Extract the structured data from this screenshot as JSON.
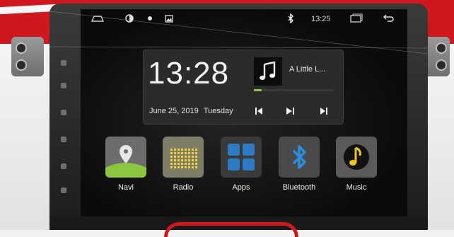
{
  "status_bar": {
    "bluetooth_icon": "bluetooth-icon",
    "time": "13:25"
  },
  "clock_widget": {
    "time": "13:28",
    "date": "June 25, 2019",
    "weekday": "Tuesday"
  },
  "now_playing": {
    "track": "A Little L...",
    "progress": 0.1
  },
  "apps": [
    {
      "label": "Navi",
      "icon": "map-pin-icon",
      "color": "#7a7a7a"
    },
    {
      "label": "Radio",
      "icon": "radio-grid-icon",
      "color": "#8a8a6a"
    },
    {
      "label": "Apps",
      "icon": "apps-grid-icon",
      "color": "#2c7bc4"
    },
    {
      "label": "Bluetooth",
      "icon": "bluetooth-icon",
      "color": "#1e88d8"
    },
    {
      "label": "Music",
      "icon": "music-note-icon",
      "color": "#f0c419"
    }
  ],
  "colors": {
    "brand_red": "#d0161f",
    "progress_green": "#8dc63f"
  }
}
